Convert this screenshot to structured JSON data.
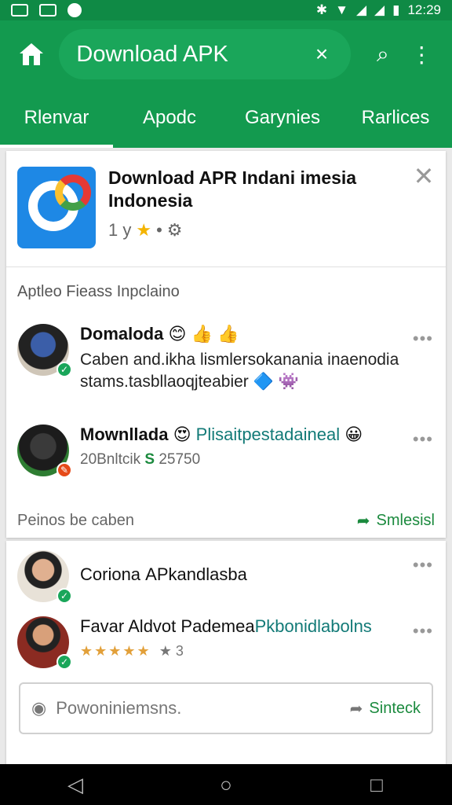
{
  "status_bar": {
    "time": "12:29",
    "icons": [
      "image-icon",
      "news-icon",
      "sync-icon",
      "bluetooth-icon",
      "wifi-icon",
      "signal-icon",
      "signal-icon",
      "battery-icon"
    ]
  },
  "toolbar": {
    "search_text": "Download APK",
    "clear_glyph": "×",
    "search_glyph": "⌕",
    "menu_glyph": "⋮"
  },
  "tabs": [
    {
      "label": "Rlenvar",
      "active": true
    },
    {
      "label": "Apodc",
      "active": false
    },
    {
      "label": "Garynies",
      "active": false
    },
    {
      "label": "Rarlices",
      "active": false
    }
  ],
  "app": {
    "title": "Download APR Indani imesia Indonesia",
    "meta_text": "1 y",
    "star_glyph": "★",
    "dot": "•",
    "close_glyph": "✕"
  },
  "section": {
    "heading": "Aptleo Fieass Inpclaino"
  },
  "reviews": [
    {
      "name": "Domaloda",
      "emoji": "😊 👍 👍",
      "text": "Caben and.ikha lismlersokanania inaenodia stams.tasbllaoqjteabier",
      "emoji2": "🔷 👾"
    },
    {
      "name": "Mownllada",
      "emoji": "😍",
      "name_tail": "Plisaitpestadaineal",
      "emoji_end": "😀",
      "sub_prefix": "20Bnltcik",
      "sub_value": "S",
      "sub_suffix": "25750"
    }
  ],
  "card1_footer": {
    "left": "Peinos be caben",
    "right": "Smlesisl"
  },
  "more_reviews": [
    {
      "name": "Corionа APkandlasba"
    },
    {
      "name": "Favar Aldvot Pademea",
      "name_tail": "Pkbonidlabolns",
      "stars": "★★★★★",
      "count_star": "★",
      "count": "3"
    }
  ],
  "comment": {
    "placeholder": "Powoniniemsns.",
    "send_label": "Sinteck"
  },
  "nav": {
    "back": "◁",
    "home": "○",
    "recents": "□"
  }
}
